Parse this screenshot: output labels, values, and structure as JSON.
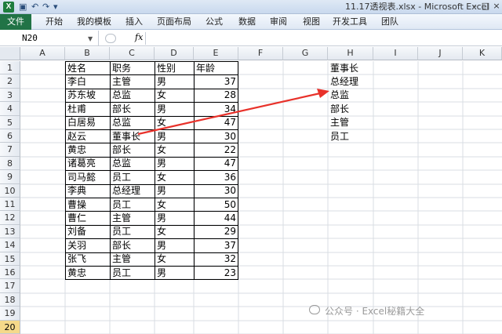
{
  "window": {
    "title": "11.17透视表.xlsx - Microsoft Excel",
    "quick_access": [
      "↶",
      "↷",
      "▾"
    ],
    "controls": [
      "–",
      "□",
      "×"
    ]
  },
  "ribbon": {
    "tabs": [
      "文件",
      "开始",
      "我的模板",
      "插入",
      "页面布局",
      "公式",
      "数据",
      "审阅",
      "视图",
      "开发工具",
      "团队"
    ]
  },
  "formula_bar": {
    "name_box": "N20",
    "fx_label": "fx",
    "value": ""
  },
  "columns": [
    "A",
    "B",
    "C",
    "D",
    "E",
    "F",
    "G",
    "H",
    "I",
    "J",
    "K"
  ],
  "rows": [
    "1",
    "2",
    "3",
    "4",
    "5",
    "6",
    "7",
    "8",
    "9",
    "10",
    "11",
    "12",
    "13",
    "14",
    "15",
    "16",
    "17",
    "18",
    "19",
    "20"
  ],
  "active_row": "20",
  "table": {
    "headers": [
      "姓名",
      "职务",
      "性别",
      "年龄"
    ],
    "records": [
      [
        "李白",
        "主管",
        "男",
        "37"
      ],
      [
        "苏东坡",
        "总监",
        "女",
        "28"
      ],
      [
        "杜甫",
        "部长",
        "男",
        "34"
      ],
      [
        "白居易",
        "总监",
        "女",
        "47"
      ],
      [
        "赵云",
        "董事长",
        "男",
        "30"
      ],
      [
        "黄忠",
        "部长",
        "女",
        "22"
      ],
      [
        "诸葛亮",
        "总监",
        "男",
        "47"
      ],
      [
        "司马懿",
        "员工",
        "女",
        "36"
      ],
      [
        "李典",
        "总经理",
        "男",
        "30"
      ],
      [
        "曹操",
        "员工",
        "女",
        "50"
      ],
      [
        "曹仁",
        "主管",
        "男",
        "44"
      ],
      [
        "刘备",
        "员工",
        "女",
        "29"
      ],
      [
        "关羽",
        "部长",
        "男",
        "37"
      ],
      [
        "张飞",
        "主管",
        "女",
        "32"
      ],
      [
        "黄忠",
        "员工",
        "男",
        "23"
      ]
    ]
  },
  "column_h": [
    "董事长",
    "总经理",
    "总监",
    "部长",
    "主管",
    "员工"
  ],
  "watermark": "公众号 · Excel秘籍大全",
  "colors": {
    "file_tab": "#217346",
    "arrow": "#e8312a",
    "active_row": "#f5d98a"
  }
}
